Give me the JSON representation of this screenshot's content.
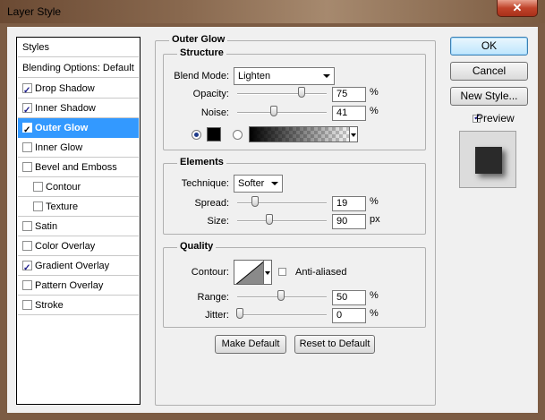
{
  "window": {
    "title": "Layer Style",
    "close_glyph": "✕"
  },
  "styles_list": {
    "header": "Styles",
    "blending": "Blending Options: Default",
    "items": [
      {
        "label": "Drop Shadow",
        "checked": true
      },
      {
        "label": "Inner Shadow",
        "checked": true
      },
      {
        "label": "Outer Glow",
        "checked": true,
        "selected": true
      },
      {
        "label": "Inner Glow",
        "checked": false
      },
      {
        "label": "Bevel and Emboss",
        "checked": false
      },
      {
        "label": "Contour",
        "checked": false,
        "indent": true
      },
      {
        "label": "Texture",
        "checked": false,
        "indent": true
      },
      {
        "label": "Satin",
        "checked": false
      },
      {
        "label": "Color Overlay",
        "checked": false
      },
      {
        "label": "Gradient Overlay",
        "checked": true
      },
      {
        "label": "Pattern Overlay",
        "checked": false
      },
      {
        "label": "Stroke",
        "checked": false
      }
    ]
  },
  "outer_glow": {
    "title": "Outer Glow",
    "structure": {
      "legend": "Structure",
      "blend_mode_label": "Blend Mode:",
      "blend_mode_value": "Lighten",
      "opacity_label": "Opacity:",
      "opacity_value": "75",
      "opacity_unit": "%",
      "opacity_level": 0.75,
      "noise_label": "Noise:",
      "noise_value": "41",
      "noise_unit": "%",
      "noise_level": 0.41,
      "color_mode": "solid",
      "color": "#000000"
    },
    "elements": {
      "legend": "Elements",
      "technique_label": "Technique:",
      "technique_value": "Softer",
      "spread_label": "Spread:",
      "spread_value": "19",
      "spread_unit": "%",
      "spread_level": 0.19,
      "size_label": "Size:",
      "size_value": "90",
      "size_unit": "px",
      "size_level": 0.36
    },
    "quality": {
      "legend": "Quality",
      "contour_label": "Contour:",
      "anti_aliased_label": "Anti-aliased",
      "anti_aliased": false,
      "range_label": "Range:",
      "range_value": "50",
      "range_unit": "%",
      "range_level": 0.5,
      "jitter_label": "Jitter:",
      "jitter_value": "0",
      "jitter_unit": "%",
      "jitter_level": 0.0
    },
    "make_default": "Make Default",
    "reset_default": "Reset to Default"
  },
  "actions": {
    "ok": "OK",
    "cancel": "Cancel",
    "new_style": "New Style...",
    "preview_label": "Preview",
    "preview_checked": true
  }
}
